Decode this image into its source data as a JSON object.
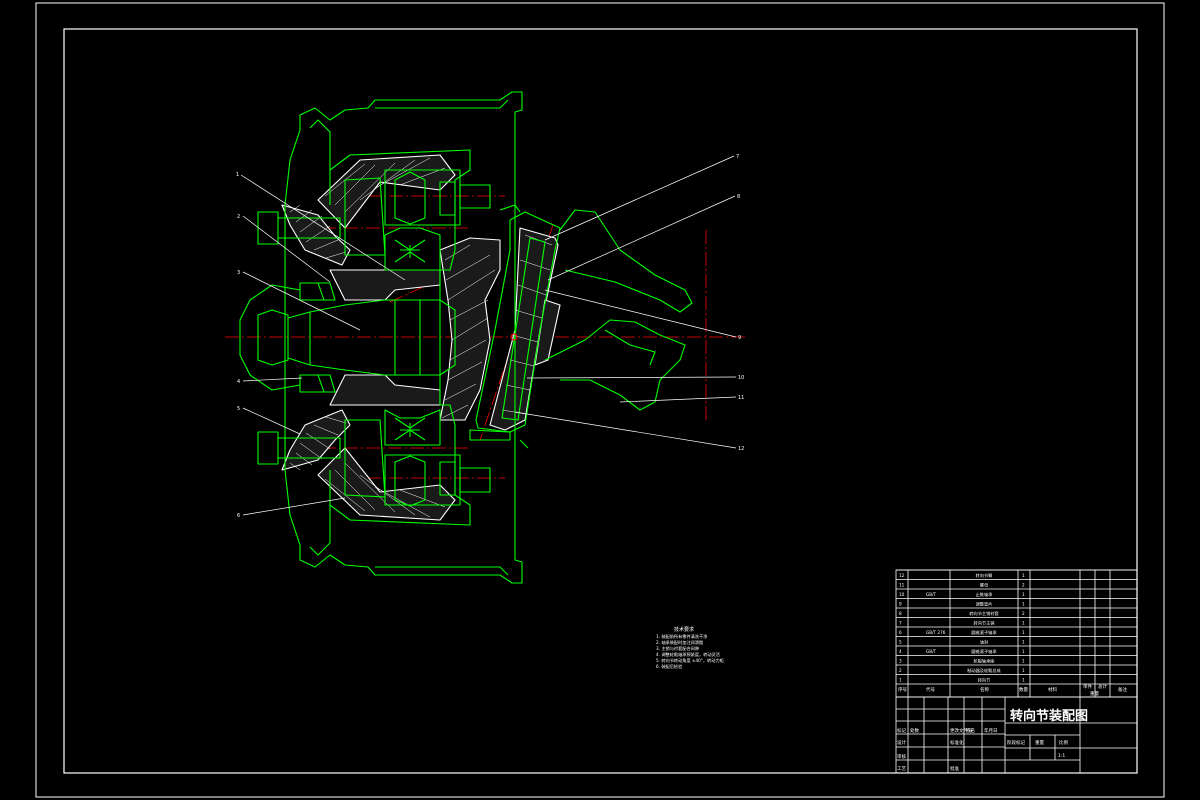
{
  "drawing": {
    "title": "转向节装配图",
    "scale": "1:1",
    "colors": {
      "background": "#000000",
      "frame": "#ffffff",
      "part_outline": "#00ff00",
      "center_line": "#ff0000",
      "hatch": "#ffffff"
    }
  },
  "callouts": [
    "1",
    "2",
    "3",
    "4",
    "5",
    "6",
    "7",
    "8",
    "9",
    "10",
    "11",
    "12"
  ],
  "tech_notes": {
    "heading": "技术要求",
    "lines": [
      "1. 装配前所有零件清洗干净",
      "2. 轴承装配时加注润滑脂",
      "3. 主销与衬套配合间隙",
      "4. 调整轮毂轴承预紧度，转动灵活",
      "5. 转向节转动角度 ±40°，转动力矩",
      "6. 装配后检验"
    ]
  },
  "bom": {
    "rows": [
      {
        "no": "12",
        "code": "",
        "name": "转向节臂",
        "qty": "1"
      },
      {
        "no": "11",
        "code": "",
        "name": "螺母",
        "qty": "2"
      },
      {
        "no": "10",
        "code": "GB/T",
        "name": "止推轴承",
        "qty": "1"
      },
      {
        "no": "9",
        "code": "",
        "name": "调整垫片",
        "qty": "1"
      },
      {
        "no": "8",
        "code": "",
        "name": "转向节主销衬套",
        "qty": "2"
      },
      {
        "no": "7",
        "code": "",
        "name": "转向节主销",
        "qty": "1"
      },
      {
        "no": "6",
        "code": "GB/T 276",
        "name": "圆锥滚子轴承",
        "qty": "1"
      },
      {
        "no": "5",
        "code": "",
        "name": "油封",
        "qty": "1"
      },
      {
        "no": "4",
        "code": "GB/T",
        "name": "圆锥滚子轴承",
        "qty": "1"
      },
      {
        "no": "3",
        "code": "",
        "name": "轮毂轴承座",
        "qty": "1"
      },
      {
        "no": "2",
        "code": "",
        "name": "制动器及轮毂总成",
        "qty": "1"
      },
      {
        "no": "1",
        "code": "",
        "name": "转向节",
        "qty": "1"
      }
    ],
    "header": {
      "no": "序号",
      "code": "代号",
      "name": "名称",
      "qty": "数量",
      "material": "材料",
      "unit_weight": "单件",
      "total_weight": "总计",
      "weight": "重量",
      "remark": "备注"
    }
  },
  "title_block": {
    "mark": "标记",
    "count": "处数",
    "file_no": "更改文件号",
    "signature": "签名",
    "date": "年月日",
    "designer": "设计",
    "standardization": "标准化",
    "checker": "审核",
    "process": "工艺",
    "approve": "批准",
    "stage_mark": "阶段标记",
    "weight": "重量",
    "scale_label": "比例"
  }
}
